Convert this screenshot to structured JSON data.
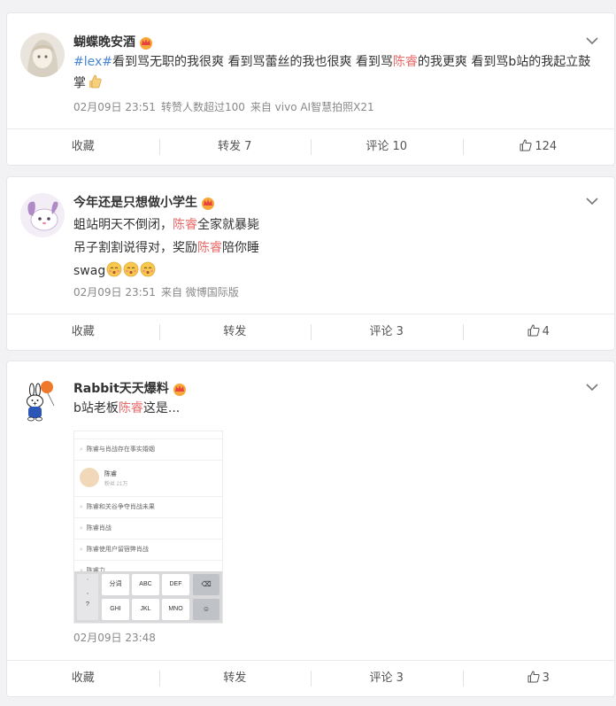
{
  "colors": {
    "highlight": "#e86b6b",
    "topic": "#4b86d3",
    "meta": "#888888",
    "background": "#f2f2f5"
  },
  "posts": [
    {
      "username": "蝴蝶晚安酒",
      "text_lines": [
        [
          "#lex#",
          "看到骂无职的我很爽 看到骂蕾丝的我也很爽 看到骂",
          "陈睿",
          "的我更爽 看到骂b站的我起立鼓"
        ],
        [
          "掌"
        ]
      ],
      "meta": {
        "time": "02月09日 23:51",
        "extra": "转赞人数超过100",
        "source": "来自 vivo AI智慧拍照X21"
      },
      "actions": {
        "collect": "收藏",
        "repost": "转发 7",
        "comment": "评论 10",
        "like": "124"
      }
    },
    {
      "username": "今年还是只想做小学生",
      "text_lines": [
        [
          "蛆站明天不倒闭，",
          "陈睿",
          "全家就暴毙"
        ],
        [
          "吊子割割说得对，奖励",
          "陈睿",
          "陪你睡"
        ],
        [
          "swag"
        ]
      ],
      "meta": {
        "time": "02月09日 23:51",
        "source": "来自 微博国际版"
      },
      "actions": {
        "collect": "收藏",
        "repost": "转发",
        "comment": "评论 3",
        "like": "4"
      }
    },
    {
      "username": "Rabbit天天爆料",
      "text_lines": [
        [
          "b站老板",
          "陈睿",
          "这是..."
        ]
      ],
      "screenshot": {
        "rows_top": [
          "陈睿与肖战存在事实婚姻"
        ],
        "profile_name": "陈睿",
        "profile_sub": "粉丝 21万",
        "rows_bottom": [
          "陈睿和关谷争夺肖战未果",
          "陈睿肖战",
          "陈睿使用户留宿弊肖战",
          "陈睿力"
        ],
        "candidates": [
          "智",
          "哥",
          "冀",
          "宝",
          "姐",
          "哲"
        ],
        "keys_row1": [
          "分词",
          "ABC",
          "DEF"
        ],
        "keys_row2": [
          "GHI",
          "JKL",
          "MNO"
        ]
      },
      "meta": {
        "time": "02月09日 23:48"
      },
      "actions": {
        "collect": "收藏",
        "repost": "转发",
        "comment": "评论 3",
        "like": "3"
      }
    }
  ]
}
